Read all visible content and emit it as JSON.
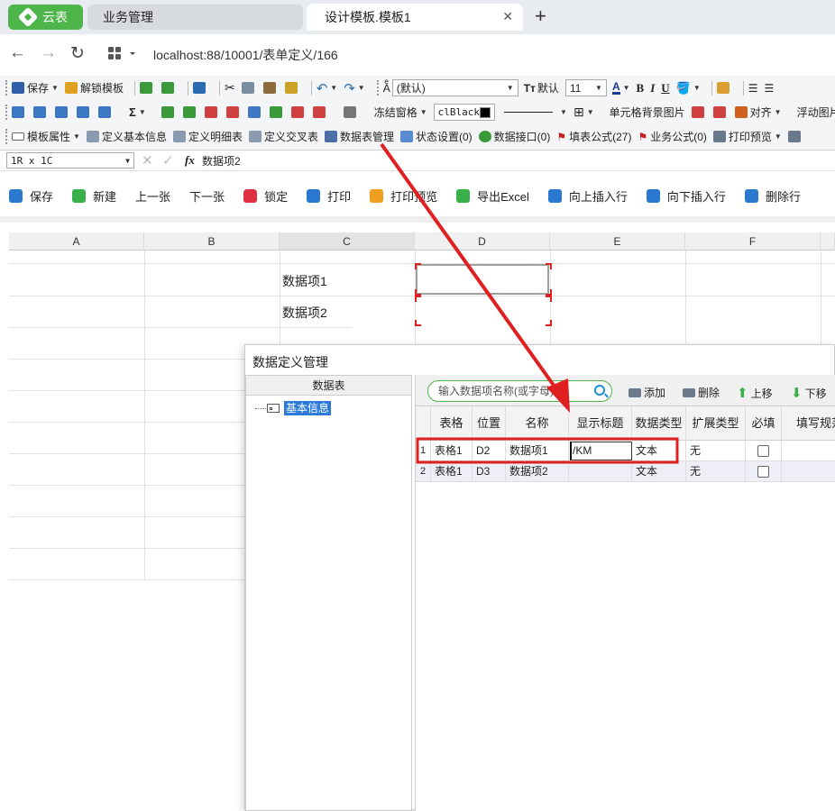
{
  "browser": {
    "tabs": [
      {
        "label": "云表"
      },
      {
        "label": "业务管理"
      },
      {
        "label": "设计模板.模板1"
      }
    ],
    "url": "localhost:88/10001/表单定义/166"
  },
  "toolbar1": {
    "save": "保存",
    "unlock_template": "解锁模板",
    "font_name": "(默认)",
    "default_label": "默认",
    "font_size": "11",
    "bold": "B",
    "italic": "I",
    "underline": "U"
  },
  "toolbar2": {
    "sum": "Σ",
    "freeze_panes": "冻结窗格",
    "color_name": "clBlack",
    "cell_bg_image": "单元格背景图片",
    "align": "对齐",
    "float_image": "浮动图片"
  },
  "toolbar3": {
    "template_props": "模板属性",
    "define_basic": "定义基本信息",
    "define_detail": "定义明细表",
    "define_cross": "定义交叉表",
    "data_table_mgmt": "数据表管理",
    "status_settings": "状态设置(0)",
    "data_interface": "数据接口(0)",
    "fill_formula": "填表公式(27)",
    "biz_formula": "业务公式(0)",
    "print_preview": "打印预览"
  },
  "formula_bar": {
    "cell_ref": "1R x 1C",
    "fx": "fx",
    "value": "数据项2"
  },
  "actions": {
    "save": "保存",
    "new": "新建",
    "prev": "上一张",
    "next": "下一张",
    "lock": "锁定",
    "print": "打印",
    "print_preview": "打印预览",
    "export_excel": "导出Excel",
    "insert_above": "向上插入行",
    "insert_below": "向下插入行",
    "delete_row": "删除行"
  },
  "sheet": {
    "columns": [
      "A",
      "B",
      "C",
      "D",
      "E",
      "F"
    ],
    "c2": "数据项1",
    "c3": "数据项2"
  },
  "dialog": {
    "title": "数据定义管理",
    "tree_header": "数据表",
    "tree_item": "基本信息",
    "search_placeholder": "输入数据项名称(或字母)",
    "buttons": {
      "add": "添加",
      "delete": "删除",
      "up": "上移",
      "down": "下移"
    },
    "columns": [
      "表格",
      "位置",
      "名称",
      "显示标题",
      "数据类型",
      "扩展类型",
      "必填",
      "填写规范"
    ],
    "rows": [
      {
        "num": "1",
        "table": "表格1",
        "pos": "D2",
        "name": "数据项1",
        "title": "/KM",
        "dtype": "文本",
        "ext": "无",
        "required": false
      },
      {
        "num": "2",
        "table": "表格1",
        "pos": "D3",
        "name": "数据项2",
        "title": "",
        "dtype": "文本",
        "ext": "无",
        "required": false
      }
    ]
  },
  "annotation": {
    "highlight_color": "#e02020"
  }
}
